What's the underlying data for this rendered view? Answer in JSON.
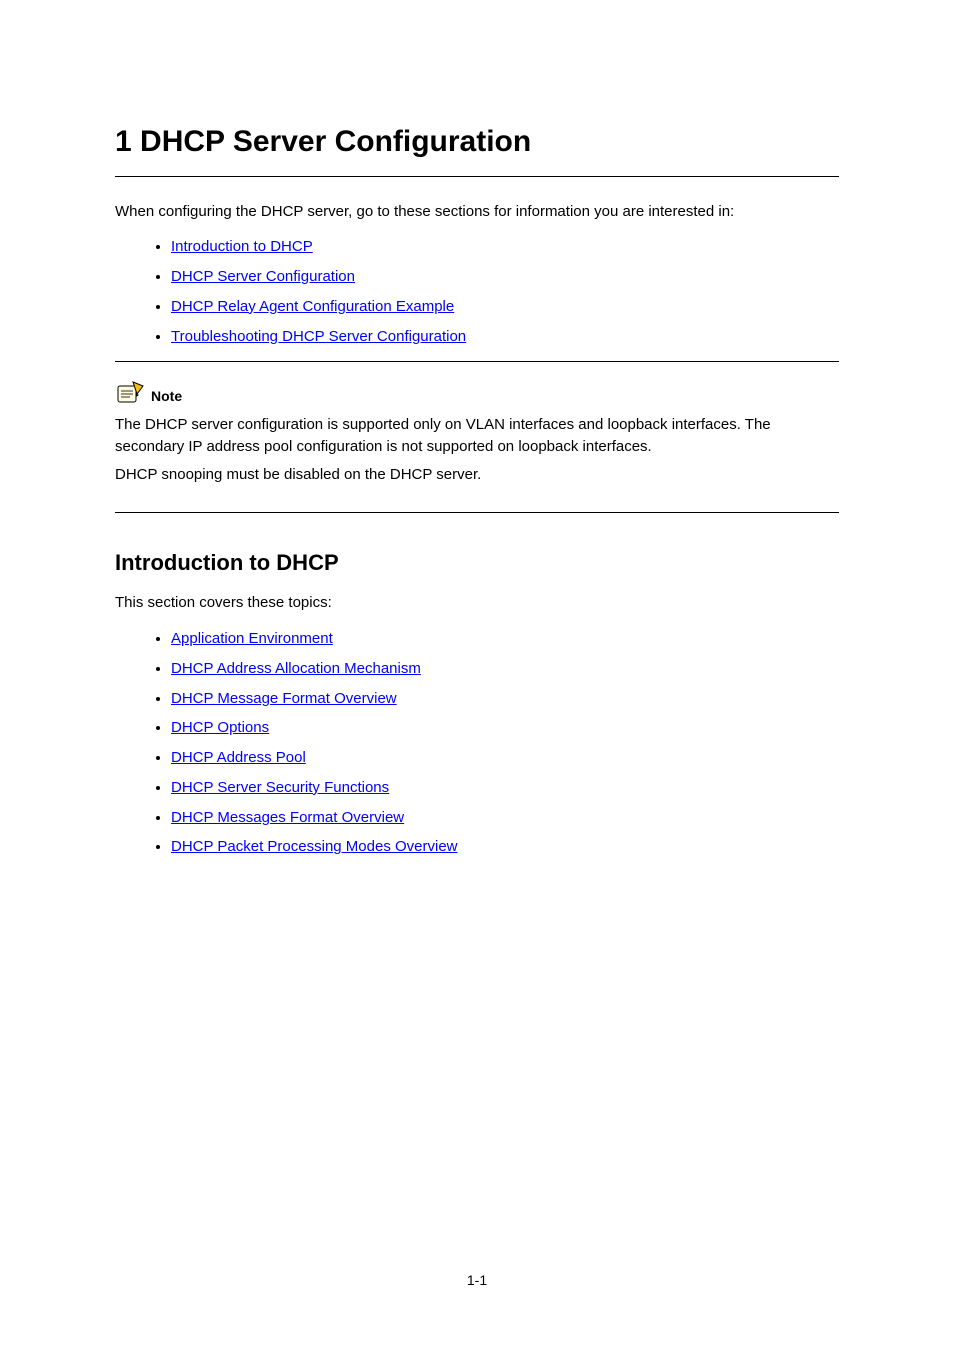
{
  "chapter": {
    "number_label": "1",
    "title_prefix": "DHCP Server Configuration"
  },
  "intro": "When configuring the DHCP server, go to these sections for information you are interested in:",
  "top_links": [
    "Introduction to DHCP",
    "DHCP Server Configuration",
    "DHCP Relay Agent Configuration Example",
    "Troubleshooting DHCP Server Configuration"
  ],
  "note": {
    "label": "Note",
    "lines": [
      "The DHCP server configuration is supported only on VLAN interfaces and loopback interfaces. The secondary IP address pool configuration is not supported on loopback interfaces.",
      "DHCP snooping must be disabled on the DHCP server."
    ]
  },
  "section_title": "Introduction to DHCP",
  "section_intro": "This section covers these topics:",
  "section_links": [
    "Application Environment",
    "DHCP Address Allocation Mechanism",
    "DHCP Message Format Overview",
    "DHCP Options",
    "DHCP Address Pool",
    "DHCP Server Security Functions",
    "DHCP Messages Format Overview",
    "DHCP Packet Processing Modes Overview"
  ],
  "page_number": "1-1"
}
